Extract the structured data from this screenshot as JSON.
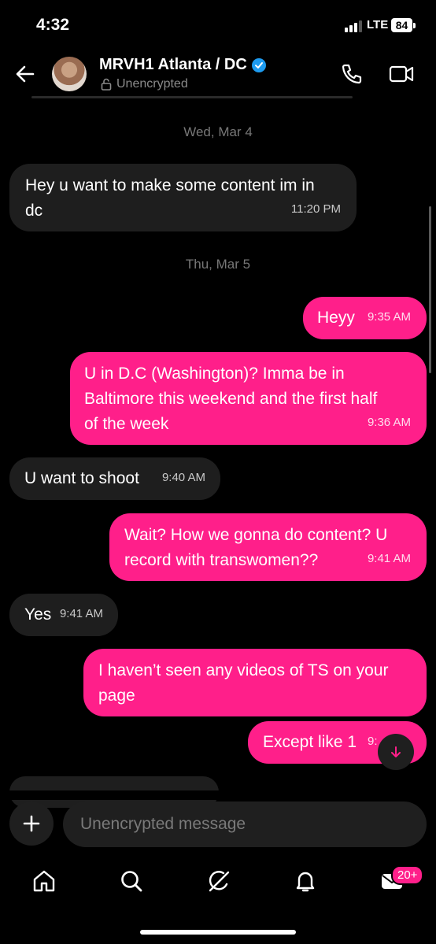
{
  "status_bar": {
    "time": "4:32",
    "network": "LTE",
    "battery": "84"
  },
  "header": {
    "name": "MRVH1 Atlanta / DC",
    "subtitle": "Unencrypted"
  },
  "dates": {
    "first": "Wed, Mar 4",
    "second": "Thu, Mar 5"
  },
  "messages": [
    {
      "direction": "in",
      "line1": "Hey u want to make some content im in",
      "line2": "dc",
      "time": "11:20 PM"
    },
    {
      "direction": "out",
      "text": "Heyy",
      "time": "9:35 AM"
    },
    {
      "direction": "out",
      "line1": "U in D.C (Washington)? Imma be in",
      "line2": "Baltimore this weekend and the first half",
      "line3": "of the week",
      "time": "9:36 AM"
    },
    {
      "direction": "in",
      "text": "U want to shoot",
      "time": "9:40 AM"
    },
    {
      "direction": "out",
      "line1": "Wait? How we gonna do content? U",
      "line2": "record with transwomen??",
      "time": "9:41 AM"
    },
    {
      "direction": "in",
      "text": "Yes",
      "time": "9:41 AM"
    },
    {
      "direction": "out",
      "line1": "I haven’t seen any videos of TS on your",
      "line2": "page",
      "time": ""
    },
    {
      "direction": "out",
      "text": "Except like 1",
      "time": "9:"
    }
  ],
  "composer": {
    "placeholder": "Unencrypted message"
  },
  "nav": {
    "messages_badge": "20+"
  },
  "icons": [
    "back-arrow-icon",
    "verified-icon",
    "lock-icon",
    "phone-icon",
    "video-icon",
    "scroll-down-icon",
    "plus-icon",
    "home-icon",
    "search-icon",
    "grok-icon",
    "bell-icon",
    "mail-icon"
  ],
  "colors": {
    "accent": "#ff1f8a",
    "incoming_bubble": "#1e1e1e",
    "verified": "#1d9bf0"
  }
}
